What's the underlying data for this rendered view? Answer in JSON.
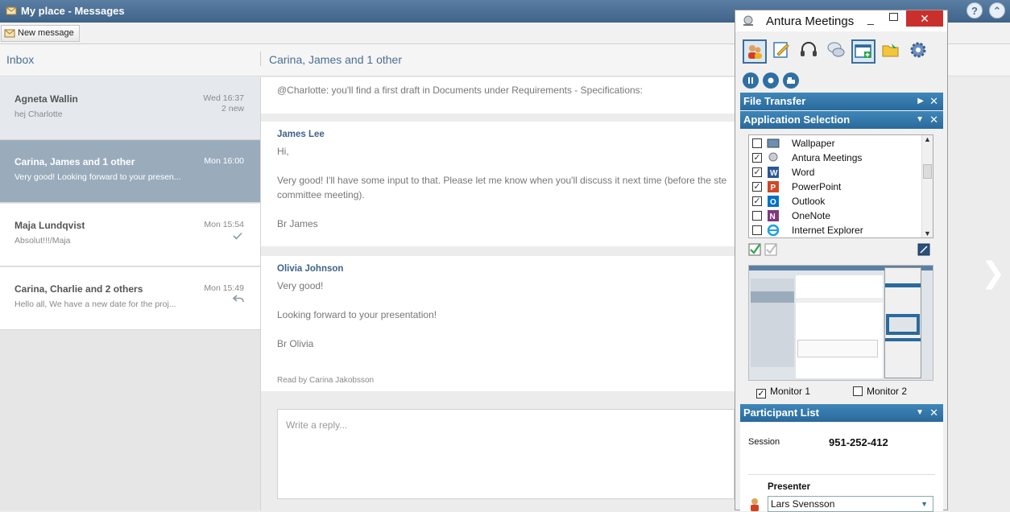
{
  "window": {
    "title": "My place - Messages",
    "help_label": "?",
    "collapse_label": "⌃"
  },
  "toolbar": {
    "new_message_label": "New message"
  },
  "inbox": {
    "label": "Inbox"
  },
  "conversation": {
    "title": "Carina, James and 1 other"
  },
  "threads": [
    {
      "name": "Agneta Wallin",
      "preview": "hej Charlotte",
      "time": "Wed 16:37",
      "badge": "2 new",
      "status_icon": ""
    },
    {
      "name": "Carina, James and 1 other",
      "preview": "Very good! Looking forward to your presen...",
      "time": "Mon 16:00",
      "badge": "",
      "status_icon": ""
    },
    {
      "name": "Maja Lundqvist",
      "preview": "Absolut!!!/Maja",
      "time": "Mon 15:54",
      "badge": "",
      "status_icon": "checkmark-icon"
    },
    {
      "name": "Carina, Charlie and 2 others",
      "preview": "Hello all, We have a new date for the proj...",
      "time": "Mon 15:49",
      "badge": "",
      "status_icon": "reply-icon"
    }
  ],
  "messages": [
    {
      "author": "",
      "lines": [
        "@Charlotte: you'll find a first draft in Documents under Requirements - Specifications:"
      ]
    },
    {
      "author": "James Lee",
      "lines": [
        "Hi,",
        "Very good! I'll have some input to that. Please let me know when you'll discuss it next time (before the ste",
        "committee meeting).",
        "Br James"
      ]
    },
    {
      "author": "Olivia Johnson",
      "lines": [
        "Very good!",
        "Looking forward to your presentation!",
        "Br Olivia"
      ],
      "read_by": "Read by Carina Jakobsson"
    }
  ],
  "reply": {
    "placeholder": "Write a reply..."
  },
  "meetings": {
    "title": "Antura Meetings",
    "min_label": "_",
    "close_label": "✕",
    "tools": [
      "participants-icon",
      "notes-icon",
      "headset-icon",
      "chat-icon",
      "share-screen-icon",
      "folder-icon",
      "settings-icon"
    ],
    "controls": [
      "pause-icon",
      "record-icon",
      "print-icon"
    ],
    "sections": {
      "file_transfer": "File Transfer",
      "app_selection": "Application Selection",
      "participant_list": "Participant List"
    },
    "apps": [
      {
        "name": "Wallpaper",
        "checked": false,
        "icon": "wallpaper-icon",
        "color": "#6d8fb5"
      },
      {
        "name": "Antura Meetings",
        "checked": true,
        "icon": "antura-icon",
        "color": "#9aa4ad"
      },
      {
        "name": "Word",
        "checked": true,
        "icon": "word-icon",
        "color": "#2b5797"
      },
      {
        "name": "PowerPoint",
        "checked": true,
        "icon": "powerpoint-icon",
        "color": "#d24726"
      },
      {
        "name": "Outlook",
        "checked": true,
        "icon": "outlook-icon",
        "color": "#0072c6"
      },
      {
        "name": "OneNote",
        "checked": false,
        "icon": "onenote-icon",
        "color": "#80397b"
      },
      {
        "name": "Internet Explorer",
        "checked": false,
        "icon": "ie-icon",
        "color": "#1ba1e2"
      }
    ],
    "monitors": [
      {
        "label": "Monitor 1",
        "checked": true
      },
      {
        "label": "Monitor 2",
        "checked": false
      }
    ],
    "session_label": "Session",
    "session_id": "951-252-412",
    "presenter_label": "Presenter",
    "presenter_value": "Lars Svensson"
  }
}
